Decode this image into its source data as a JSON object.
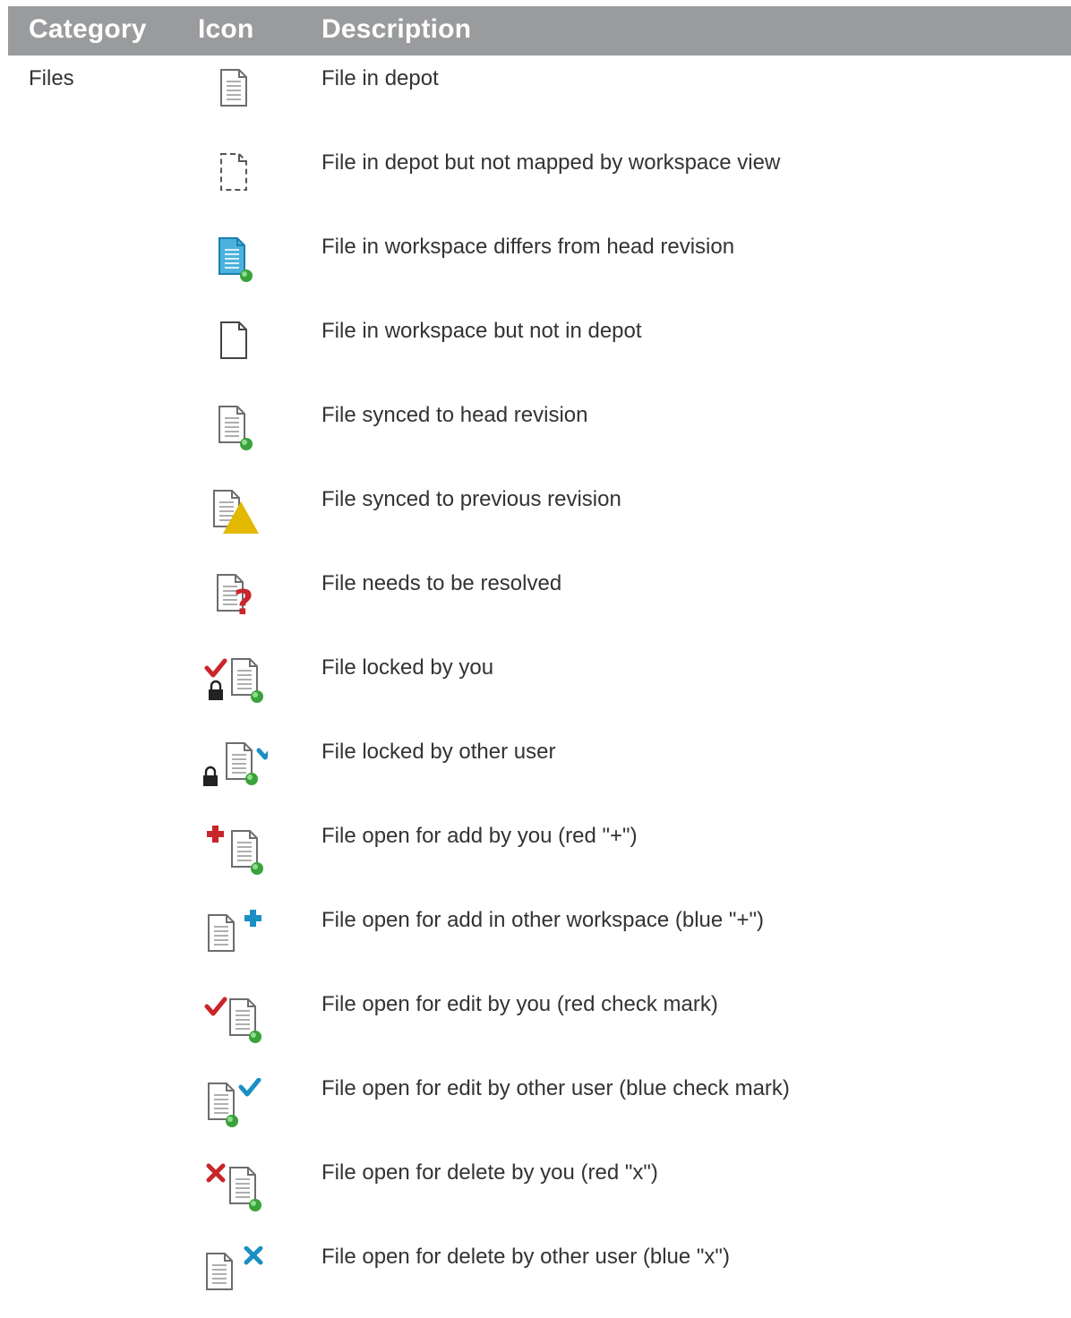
{
  "header": {
    "category": "Category",
    "icon": "Icon",
    "description": "Description"
  },
  "rows": [
    {
      "category": "Files",
      "icon": "file-icon",
      "description": "File in depot"
    },
    {
      "category": "",
      "icon": "file-unmapped-icon",
      "description": "File in depot but not mapped by workspace view"
    },
    {
      "category": "",
      "icon": "file-differs-icon",
      "description": "File in workspace differs from head revision"
    },
    {
      "category": "",
      "icon": "file-local-only-icon",
      "description": "File in workspace but not in depot"
    },
    {
      "category": "",
      "icon": "file-synced-head-icon",
      "description": "File synced to head revision"
    },
    {
      "category": "",
      "icon": "file-synced-previous-icon",
      "description": "File synced to previous revision"
    },
    {
      "category": "",
      "icon": "file-needs-resolve-icon",
      "description": "File needs to be resolved"
    },
    {
      "category": "",
      "icon": "file-locked-by-you-icon",
      "description": "File locked by you"
    },
    {
      "category": "",
      "icon": "file-locked-by-other-icon",
      "description": "File locked by other user"
    },
    {
      "category": "",
      "icon": "file-add-by-you-icon",
      "description": "File open for add by you (red \"+\")"
    },
    {
      "category": "",
      "icon": "file-add-by-other-icon",
      "description": "File open for add in other workspace (blue \"+\")"
    },
    {
      "category": "",
      "icon": "file-edit-by-you-icon",
      "description": "File open for edit by you (red check mark)"
    },
    {
      "category": "",
      "icon": "file-edit-by-other-icon",
      "description": "File open for edit by other user (blue check mark)"
    },
    {
      "category": "",
      "icon": "file-delete-by-you-icon",
      "description": "File open for delete by you (red \"x\")"
    },
    {
      "category": "",
      "icon": "file-delete-by-other-icon",
      "description": "File open for delete by other user (blue \"x\")"
    }
  ],
  "colors": {
    "header_bg": "#9a9b9d",
    "red": "#c8262b",
    "blue": "#1a8fc4",
    "green": "#3aa23a",
    "yellow": "#e3b800"
  }
}
